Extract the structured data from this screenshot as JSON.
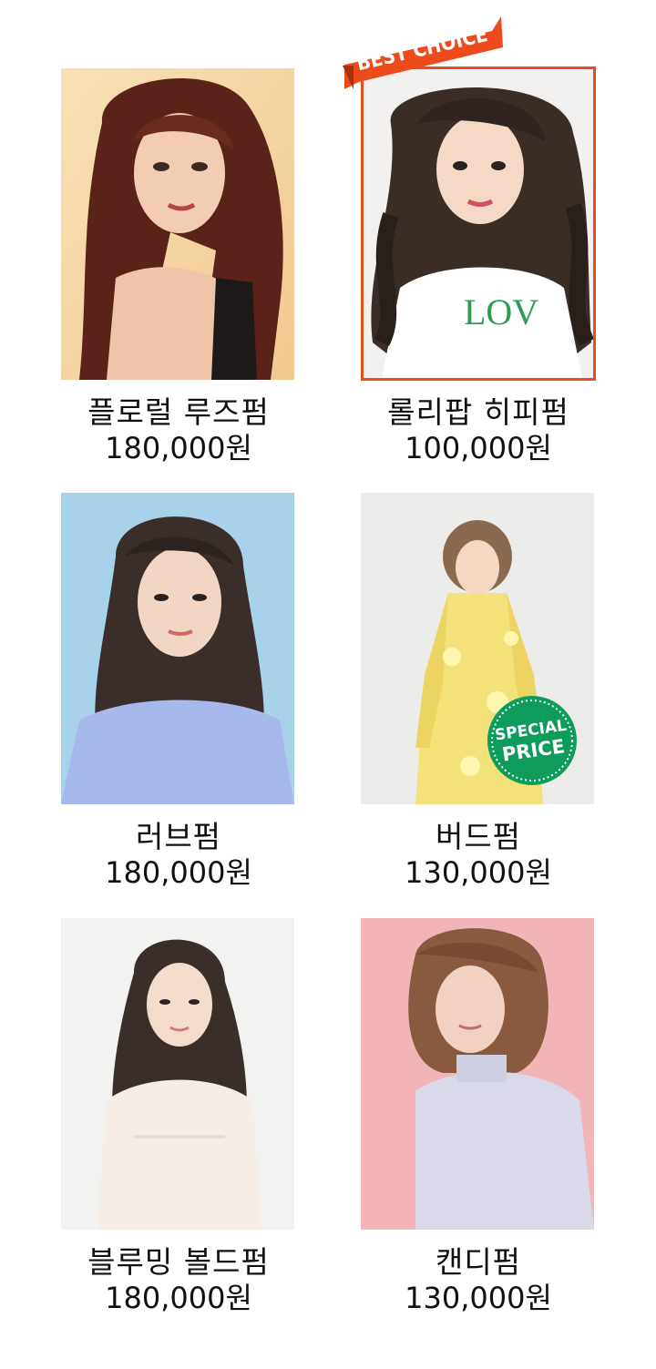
{
  "badges": {
    "best": "BEST CHOICE",
    "special_line1": "SPECIAL",
    "special_line2": "PRICE"
  },
  "colors": {
    "best_accent": "#ee4b1d",
    "special_accent": "#0e9c5d"
  },
  "products": [
    {
      "name": "플로럴 루즈펌",
      "price": "180,000원",
      "photo": "long-wavy-red-brown-hair-model"
    },
    {
      "name": "롤리팝 히피펌",
      "price": "100,000원",
      "photo": "long-curly-dark-hair-model"
    },
    {
      "name": "러브펌",
      "price": "180,000원",
      "photo": "long-wave-dark-hair-model"
    },
    {
      "name": "버드펌",
      "price": "130,000원",
      "photo": "short-bob-model-yellow-dress"
    },
    {
      "name": "블루밍 볼드펌",
      "price": "180,000원",
      "photo": "long-wavy-hair-lace-dress-model"
    },
    {
      "name": "캔디펌",
      "price": "130,000원",
      "photo": "short-curled-bob-model-pink-bg"
    }
  ]
}
